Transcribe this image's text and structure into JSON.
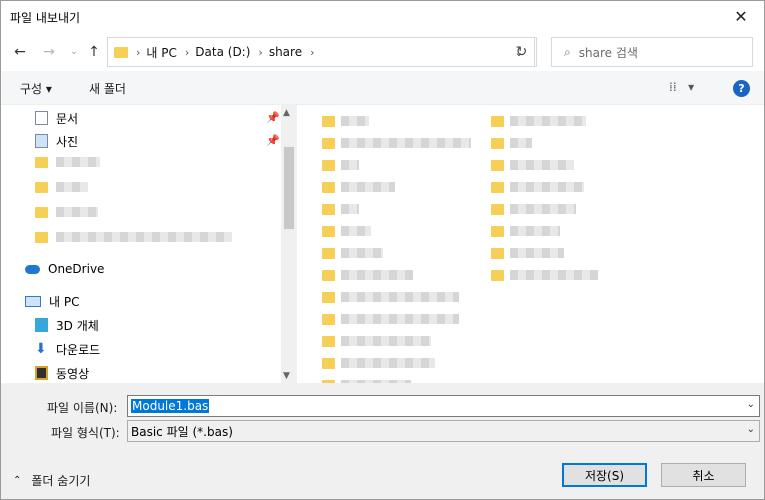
{
  "window": {
    "title": "파일 내보내기"
  },
  "nav": {
    "breadcrumbs": [
      "내 PC",
      "Data (D:)",
      "share"
    ],
    "search_placeholder": "share 검색"
  },
  "toolbar": {
    "organize": "구성 ▾",
    "new_folder": "새 폴더"
  },
  "navpane": {
    "quick": [
      {
        "label": "문서",
        "icon": "document-icon"
      },
      {
        "label": "사진",
        "icon": "pictures-icon"
      }
    ],
    "onedrive": "OneDrive",
    "this_pc": "내 PC",
    "pc_items": [
      {
        "label": "3D 개체",
        "icon": "cube-icon"
      },
      {
        "label": "다운로드",
        "icon": "download-arrow-icon"
      },
      {
        "label": "동영상",
        "icon": "video-icon"
      }
    ]
  },
  "bottom": {
    "filename_label": "파일 이름(N):",
    "filename_value": "Module1.bas",
    "filetype_label": "파일 형식(T):",
    "filetype_value": "Basic 파일 (*.bas)",
    "hide_folders": "폴더 숨기기",
    "save": "저장(S)",
    "cancel": "취소"
  },
  "colors": {
    "accent": "#0078d7",
    "folder": "#f6cf57",
    "help": "#1a64c3"
  }
}
